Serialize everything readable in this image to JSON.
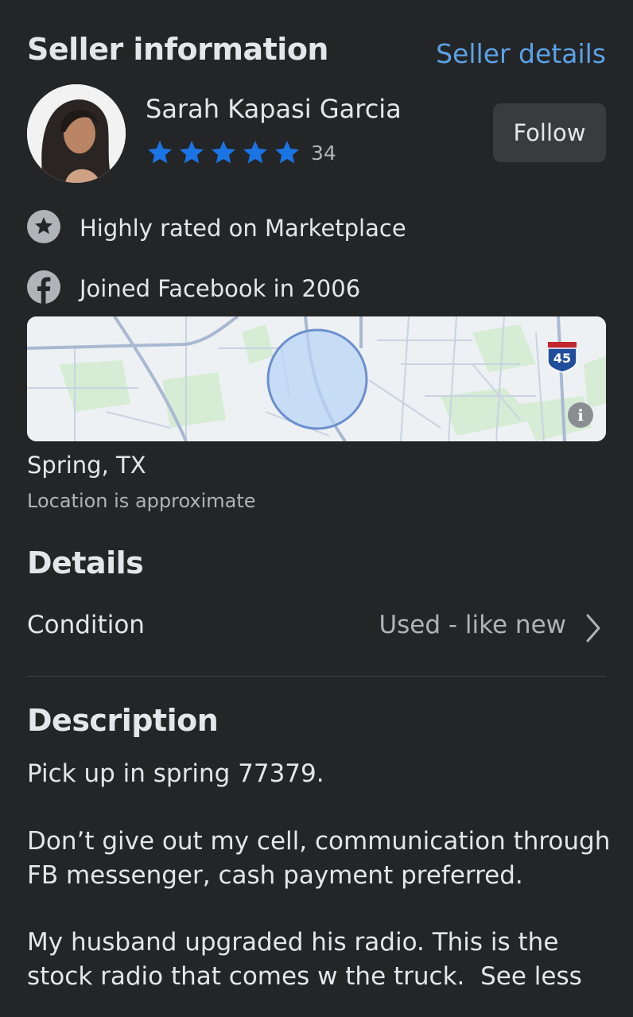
{
  "seller": {
    "section_title": "Seller information",
    "details_link": "Seller details",
    "name": "Sarah Kapasi Garcia",
    "rating_stars": 5,
    "rating_count": "34",
    "follow_label": "Follow",
    "badges": [
      {
        "icon": "star-circle-icon",
        "text": "Highly rated on Marketplace"
      },
      {
        "icon": "facebook-icon",
        "text": "Joined Facebook in 2006"
      }
    ]
  },
  "map": {
    "highway_shield": "45",
    "info_icon": "info-icon"
  },
  "location": {
    "name": "Spring, TX",
    "note": "Location is approximate"
  },
  "details": {
    "section_title": "Details",
    "condition_label": "Condition",
    "condition_value": "Used - like new"
  },
  "description": {
    "section_title": "Description",
    "paragraphs": [
      "Pick up in spring 77379.",
      "Don’t give out my cell, communication through FB messenger, cash payment preferred.",
      "My husband upgraded his radio. This is the stock radio that comes w the truck."
    ],
    "see_less": "See less"
  },
  "colors": {
    "background": "#242526",
    "accent_link": "#5aa2e8",
    "star_blue": "#1b74e4",
    "button_bg": "#3a3b3c"
  }
}
